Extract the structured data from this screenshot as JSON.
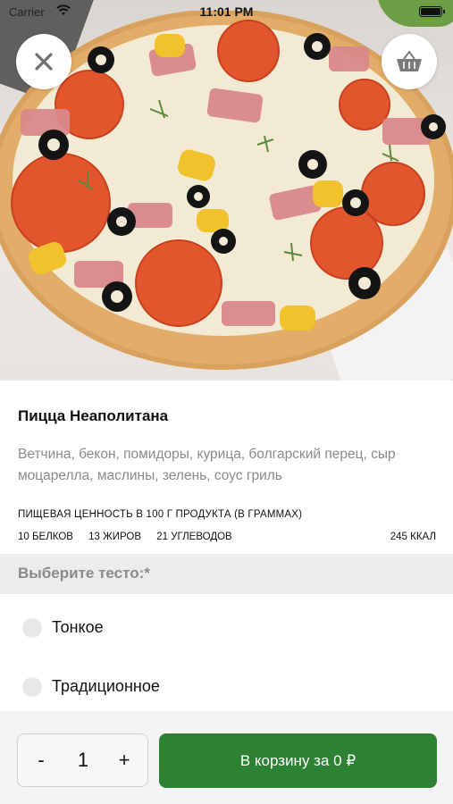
{
  "status_bar": {
    "carrier": "Carrier",
    "time": "11:01 PM"
  },
  "header": {
    "close_icon": "close-icon",
    "basket_icon": "basket-icon"
  },
  "product": {
    "title": "Пицца Неаполитана",
    "description": "Ветчина, бекон, помидоры, курица, болгарский перец, сыр моцарелла, маслины, зелень, соус гриль",
    "nutrition_title": "ПИЩЕВАЯ ЦЕННОСТЬ В 100 Г ПРОДУКТА (В ГРАММАХ)",
    "nutrition": {
      "proteins": "10 БЕЛКОВ",
      "fats": "13 ЖИРОВ",
      "carbs": "21 УГЛЕВОДОВ",
      "kcal": "245 ККАЛ"
    }
  },
  "dough": {
    "section_label": "Выберите тесто:*",
    "options": [
      {
        "label": "Тонкое"
      },
      {
        "label": "Традиционное"
      }
    ]
  },
  "bottom_bar": {
    "minus_label": "-",
    "quantity": "1",
    "plus_label": "+",
    "cart_label": "В корзину за 0 ₽"
  },
  "colors": {
    "accent": "#2c8133",
    "muted_text": "#8a8a8a",
    "section_bg": "#ececec"
  }
}
